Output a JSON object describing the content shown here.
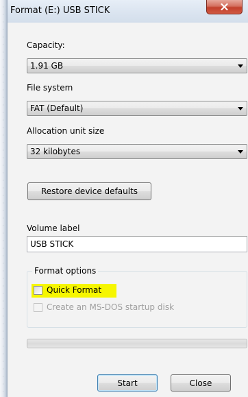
{
  "window": {
    "title": "Format (E:) USB STICK",
    "close_icon": "x-icon"
  },
  "capacity": {
    "label": "Capacity:",
    "value": "1.91 GB"
  },
  "file_system": {
    "label": "File system",
    "value": "FAT (Default)"
  },
  "allocation_unit": {
    "label": "Allocation unit size",
    "value": "32 kilobytes"
  },
  "restore_button_label": "Restore device defaults",
  "volume_label": {
    "label": "Volume label",
    "value": "USB STICK"
  },
  "format_options": {
    "title": "Format options",
    "quick_format": {
      "label": "Quick Format",
      "checked": false,
      "highlight_color": "#f6f600"
    },
    "msdos_startup": {
      "label": "Create an MS-DOS startup disk",
      "checked": false,
      "enabled": false
    }
  },
  "progress": {
    "value": 0
  },
  "buttons": {
    "start": "Start",
    "close": "Close"
  }
}
